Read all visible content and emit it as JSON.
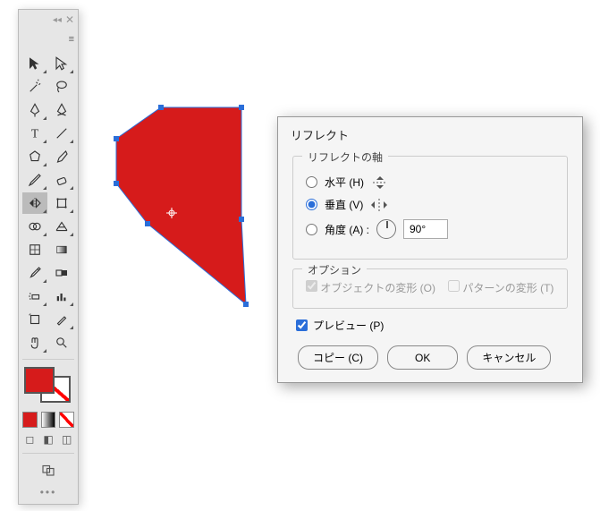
{
  "toolbar": {
    "tools": [
      "selection",
      "direct-selection",
      "magic-wand",
      "lasso",
      "pen",
      "curvature-pen",
      "type",
      "line-segment",
      "polygon",
      "paintbrush",
      "pencil",
      "eraser",
      "reflect",
      "free-transform",
      "shape-builder",
      "perspective-grid",
      "mesh",
      "gradient",
      "eyedropper",
      "blend",
      "symbol-sprayer",
      "column-graph",
      "artboard",
      "slice",
      "hand",
      "zoom"
    ],
    "selected_tool": "reflect"
  },
  "swatches": {
    "fill_color": "#d61b1b",
    "stroke": "none"
  },
  "dialog": {
    "title": "リフレクト",
    "axis_group_label": "リフレクトの軸",
    "horizontal_label": "水平 (H)",
    "vertical_label": "垂直 (V)",
    "angle_label": "角度 (A) :",
    "angle_value": "90°",
    "selected_axis": "vertical",
    "options_group_label": "オプション",
    "option_object": "オブジェクトの変形 (O)",
    "option_pattern": "パターンの変形 (T)",
    "option_object_checked": true,
    "option_pattern_checked": false,
    "preview_label": "プレビュー (P)",
    "preview_checked": true,
    "copy_button": "コピー (C)",
    "ok_button": "OK",
    "cancel_button": "キャンセル"
  },
  "shape": {
    "fill": "#d61b1b",
    "selected": true
  }
}
